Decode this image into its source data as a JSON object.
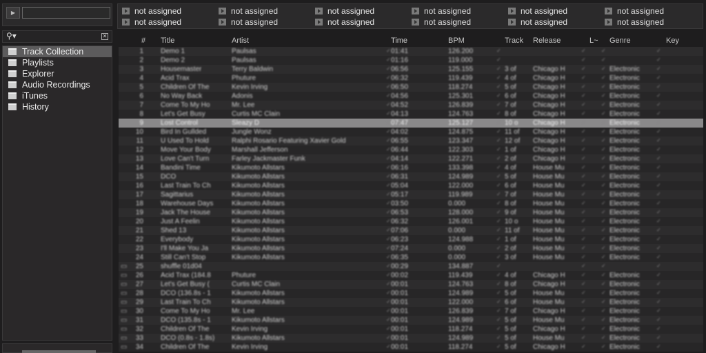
{
  "preview": {
    "play_icon": "play-icon",
    "value": ""
  },
  "favorites": [
    "not assigned",
    "not assigned",
    "not assigned",
    "not assigned",
    "not assigned",
    "not assigned",
    "not assigned",
    "not assigned",
    "not assigned",
    "not assigned",
    "not assigned",
    "not assigned"
  ],
  "search": {
    "value": ""
  },
  "tree": [
    {
      "label": "Track Collection",
      "icon": "collection-icon",
      "selected": true
    },
    {
      "label": "Playlists",
      "icon": "playlists-icon"
    },
    {
      "label": "Explorer",
      "icon": "explorer-icon"
    },
    {
      "label": "Audio Recordings",
      "icon": "recordings-icon"
    },
    {
      "label": "iTunes",
      "icon": "itunes-icon"
    },
    {
      "label": "History",
      "icon": "history-icon"
    }
  ],
  "columns": {
    "num": "#",
    "title": "Title",
    "artist": "Artist",
    "time": "Time",
    "bpm": "BPM",
    "track": "Track",
    "release": "Release",
    "label": "L~",
    "genre": "Genre",
    "key": "Key"
  },
  "selected_row": 9,
  "rows": [
    {
      "n": "1",
      "title": "Demo 1",
      "artist": "Paulsas",
      "time": "01:41",
      "bpm": "126.200",
      "track": "",
      "release": "",
      "genre": ""
    },
    {
      "n": "2",
      "title": "Demo 2",
      "artist": "Paulsas",
      "time": "01:16",
      "bpm": "119.000",
      "track": "",
      "release": "",
      "genre": ""
    },
    {
      "n": "3",
      "title": "Housemaster",
      "artist": "Terry Baldwin",
      "time": "06:56",
      "bpm": "125.155",
      "track": "3 of",
      "release": "Chicago H",
      "genre": "Electronic"
    },
    {
      "n": "4",
      "title": "Acid Trax",
      "artist": "Phuture",
      "time": "06:32",
      "bpm": "119.439",
      "track": "4 of",
      "release": "Chicago H",
      "genre": "Electronic"
    },
    {
      "n": "5",
      "title": "Children Of The",
      "artist": "Kevin Irving",
      "time": "06:50",
      "bpm": "118.274",
      "track": "5 of",
      "release": "Chicago H",
      "genre": "Electronic"
    },
    {
      "n": "6",
      "title": "No Way Back",
      "artist": "Adonis",
      "time": "04:56",
      "bpm": "125.301",
      "track": "6 of",
      "release": "Chicago H",
      "genre": "Electronic"
    },
    {
      "n": "7",
      "title": "Come To My Ho",
      "artist": "Mr. Lee",
      "time": "04:52",
      "bpm": "126.839",
      "track": "7 of",
      "release": "Chicago H",
      "genre": "Electronic"
    },
    {
      "n": "8",
      "title": "Let's Get Busy",
      "artist": "Curtis MC Clain",
      "time": "04:13",
      "bpm": "124.763",
      "track": "8 of",
      "release": "Chicago H",
      "genre": "Electronic"
    },
    {
      "n": "9",
      "title": "Lost Control",
      "artist": "Sleazy D",
      "time": "07:47",
      "bpm": "125.127",
      "track": "10 o",
      "release": "Chicago H",
      "genre": "Electronic"
    },
    {
      "n": "10",
      "title": "Bird In Gullded",
      "artist": "Jungle Wonz",
      "time": "04:02",
      "bpm": "124.875",
      "track": "11 of",
      "release": "Chicago H",
      "genre": "Electronic"
    },
    {
      "n": "11",
      "title": "U Used To Hold",
      "artist": "Ralphi Rosario Featuring Xavier Gold",
      "time": "06:55",
      "bpm": "123.347",
      "track": "12 of",
      "release": "Chicago H",
      "genre": "Electronic"
    },
    {
      "n": "12",
      "title": "Move Your Body",
      "artist": "Marshall Jefferson",
      "time": "06:44",
      "bpm": "122.303",
      "track": "1 of",
      "release": "Chicago H",
      "genre": "Electronic"
    },
    {
      "n": "13",
      "title": "Love Can't Turn",
      "artist": "Farley Jackmaster Funk",
      "time": "04:14",
      "bpm": "122.271",
      "track": "2 of",
      "release": "Chicago H",
      "genre": "Electronic"
    },
    {
      "n": "14",
      "title": "Bandini Time",
      "artist": "Kikumoto Allstars",
      "time": "06:16",
      "bpm": "133.398",
      "track": "4 of",
      "release": "House Mu",
      "genre": "Electronic"
    },
    {
      "n": "15",
      "title": "DCO",
      "artist": "Kikumoto Allstars",
      "time": "06:31",
      "bpm": "124.989",
      "track": "5 of",
      "release": "House Mu",
      "genre": "Electronic"
    },
    {
      "n": "16",
      "title": "Last Train To Ch",
      "artist": "Kikumoto Allstars",
      "time": "05:04",
      "bpm": "122.000",
      "track": "6 of",
      "release": "House Mu",
      "genre": "Electronic"
    },
    {
      "n": "17",
      "title": "Sagittarius",
      "artist": "Kikumoto Allstars",
      "time": "05:17",
      "bpm": "119.989",
      "track": "7 of",
      "release": "House Mu",
      "genre": "Electronic"
    },
    {
      "n": "18",
      "title": "Warehouse Days",
      "artist": "Kikumoto Allstars",
      "time": "03:50",
      "bpm": "0.000",
      "track": "8 of",
      "release": "House Mu",
      "genre": "Electronic"
    },
    {
      "n": "19",
      "title": "Jack The House",
      "artist": "Kikumoto Allstars",
      "time": "06:53",
      "bpm": "128.000",
      "track": "9 of",
      "release": "House Mu",
      "genre": "Electronic"
    },
    {
      "n": "20",
      "title": "Just A Feelin",
      "artist": "Kikumoto Allstars",
      "time": "06:32",
      "bpm": "126.001",
      "track": "10 o",
      "release": "House Mu",
      "genre": "Electronic"
    },
    {
      "n": "21",
      "title": "Shed 13",
      "artist": "Kikumoto Allstars",
      "time": "07:06",
      "bpm": "0.000",
      "track": "11 of",
      "release": "House Mu",
      "genre": "Electronic"
    },
    {
      "n": "22",
      "title": "Everybody",
      "artist": "Kikumoto Allstars",
      "time": "06:23",
      "bpm": "124.988",
      "track": "1 of",
      "release": "House Mu",
      "genre": "Electronic"
    },
    {
      "n": "23",
      "title": "I'll Make You Ja",
      "artist": "Kikumoto Allstars",
      "time": "07:24",
      "bpm": "0.000",
      "track": "2 of",
      "release": "House Mu",
      "genre": "Electronic"
    },
    {
      "n": "24",
      "title": "Still Can't Stop",
      "artist": "Kikumoto Allstars",
      "time": "06:35",
      "bpm": "0.000",
      "track": "3 of",
      "release": "House Mu",
      "genre": "Electronic"
    },
    {
      "n": "25",
      "title": "shuffle 01d04",
      "artist": "",
      "time": "00:29",
      "bpm": "134.887",
      "track": "",
      "release": "",
      "genre": ""
    },
    {
      "n": "26",
      "title": "Acid Trax (184.8",
      "artist": "Phuture",
      "time": "00:02",
      "bpm": "119.439",
      "track": "4 of",
      "release": "Chicago H",
      "genre": "Electronic"
    },
    {
      "n": "27",
      "title": "Let's Get Busy (",
      "artist": "Curtis MC Clain",
      "time": "00:01",
      "bpm": "124.763",
      "track": "8 of",
      "release": "Chicago H",
      "genre": "Electronic"
    },
    {
      "n": "28",
      "title": "DCO (136.8s - 1",
      "artist": "Kikumoto Allstars",
      "time": "00:01",
      "bpm": "124.989",
      "track": "5 of",
      "release": "House Mu",
      "genre": "Electronic"
    },
    {
      "n": "29",
      "title": "Last Train To Ch",
      "artist": "Kikumoto Allstars",
      "time": "00:01",
      "bpm": "122.000",
      "track": "6 of",
      "release": "House Mu",
      "genre": "Electronic"
    },
    {
      "n": "30",
      "title": "Come To My Ho",
      "artist": "Mr. Lee",
      "time": "00:01",
      "bpm": "126.839",
      "track": "7 of",
      "release": "Chicago H",
      "genre": "Electronic"
    },
    {
      "n": "31",
      "title": "DCO (135.8s - 1",
      "artist": "Kikumoto Allstars",
      "time": "00:01",
      "bpm": "124.989",
      "track": "5 of",
      "release": "House Mu",
      "genre": "Electronic"
    },
    {
      "n": "32",
      "title": "Children Of The",
      "artist": "Kevin Irving",
      "time": "00:01",
      "bpm": "118.274",
      "track": "5 of",
      "release": "Chicago H",
      "genre": "Electronic"
    },
    {
      "n": "33",
      "title": "DCO (0.8s - 1.8s)",
      "artist": "Kikumoto Allstars",
      "time": "00:01",
      "bpm": "124.989",
      "track": "5 of",
      "release": "House Mu",
      "genre": "Electronic"
    },
    {
      "n": "34",
      "title": "Children Of The",
      "artist": "Kevin Irving",
      "time": "00:01",
      "bpm": "118.274",
      "track": "5 of",
      "release": "Chicago H",
      "genre": "Electronic"
    }
  ]
}
